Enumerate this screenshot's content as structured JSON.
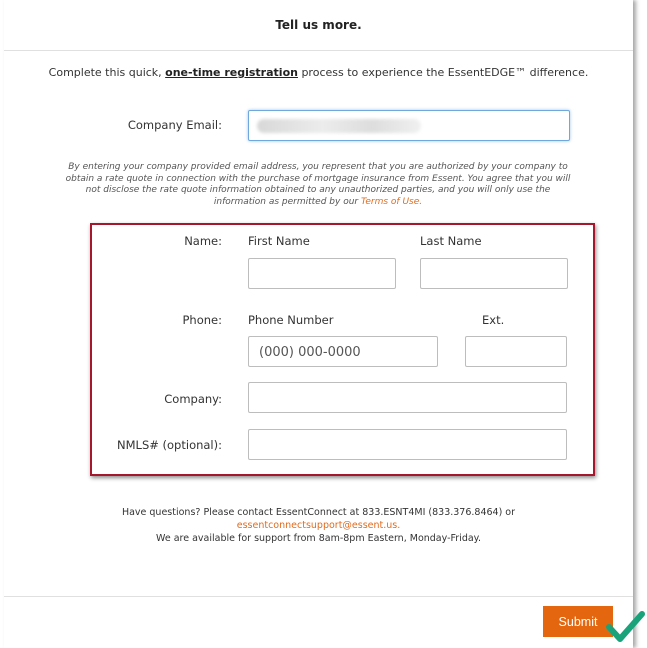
{
  "header": {
    "title": "Tell us more."
  },
  "intro": {
    "prefix": "Complete this quick, ",
    "link": "one-time registration",
    "suffix": " process to experience the EssentEDGE™ difference."
  },
  "email": {
    "label": "Company Email:",
    "value": ""
  },
  "disclaimer": {
    "text": "By entering your company provided email address, you represent that you are authorized by your company to obtain a rate quote in connection with the purchase of mortgage insurance from Essent. You agree that you will not disclose the rate quote information obtained to any unauthorized parties, and you will only use the information as permitted by our ",
    "terms": "Terms of Use."
  },
  "form": {
    "name_label": "Name:",
    "first_name_label": "First Name",
    "last_name_label": "Last Name",
    "phone_label": "Phone:",
    "phone_number_label": "Phone Number",
    "ext_label": "Ext.",
    "phone_placeholder": "(000) 000-0000",
    "company_label": "Company:",
    "nmls_label": "NMLS# (optional):"
  },
  "support": {
    "line1": "Have questions? Please contact EssentConnect at 833.ESNT4MI (833.376.8464) or",
    "email": "essentconnectsupport@essent.us.",
    "line3": "We are available for support from 8am-8pm Eastern, Monday-Friday."
  },
  "submit": {
    "label": "Submit"
  },
  "colors": {
    "accent": "#e4670f",
    "highlight_box": "#a5172c",
    "checkmark": "#1aa37a"
  },
  "icons": {
    "checkmark": "check-icon"
  }
}
